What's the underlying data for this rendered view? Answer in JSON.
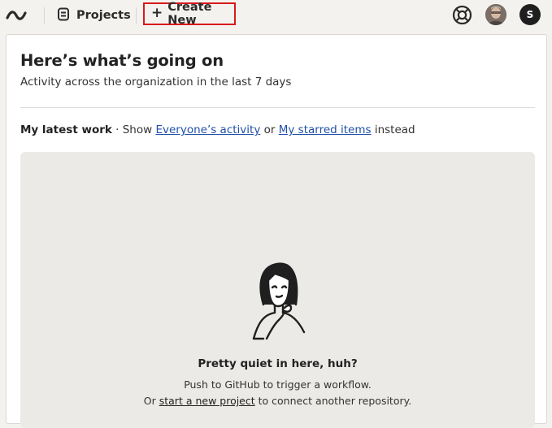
{
  "topbar": {
    "logo_icon": "brand-wave-icon",
    "projects_icon": "projects-icon",
    "projects_label": "Projects",
    "create_icon": "plus-icon",
    "create_label": "Create New",
    "help_icon": "lifebuoy-icon",
    "user_initial": "S"
  },
  "header": {
    "title": "Here’s what’s going on",
    "subtitle": "Activity across the organization in the last 7 days"
  },
  "filter": {
    "current": "My latest work",
    "sep": " · Show ",
    "link_everyone": "Everyone’s activity",
    "or": " or ",
    "link_starred": "My starred items",
    "suffix": " instead"
  },
  "empty_state": {
    "title": "Pretty quiet in here, huh?",
    "line1": "Push to GitHub to trigger a workflow.",
    "line2_prefix": "Or ",
    "line2_link": "start a new project",
    "line2_suffix": " to connect another repository."
  },
  "colors": {
    "page_bg": "#f4f2ef",
    "highlight_border": "#d7191c",
    "link": "#1f4fa8"
  }
}
